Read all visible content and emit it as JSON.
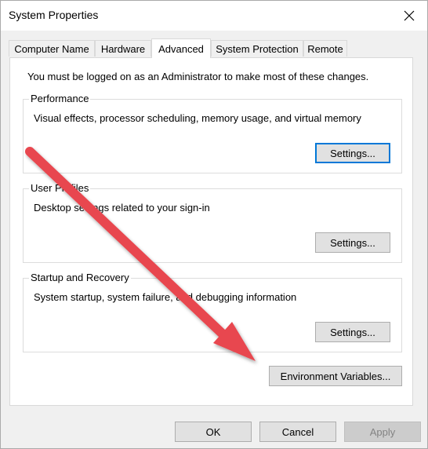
{
  "window": {
    "title": "System Properties",
    "close_glyph": "✕"
  },
  "tabs": [
    {
      "label": "Computer Name"
    },
    {
      "label": "Hardware"
    },
    {
      "label": "Advanced",
      "active": true
    },
    {
      "label": "System Protection"
    },
    {
      "label": "Remote"
    }
  ],
  "advanced": {
    "admin_notice": "You must be logged on as an Administrator to make most of these changes.",
    "performance": {
      "title": "Performance",
      "description": "Visual effects, processor scheduling, memory usage, and virtual memory",
      "button": "Settings..."
    },
    "user_profiles": {
      "title": "User Profiles",
      "description": "Desktop settings related to your sign-in",
      "button": "Settings..."
    },
    "startup_recovery": {
      "title": "Startup and Recovery",
      "description": "System startup, system failure, and debugging information",
      "button": "Settings..."
    },
    "env_button": "Environment Variables..."
  },
  "footer": {
    "ok": "OK",
    "cancel": "Cancel",
    "apply": "Apply"
  },
  "colors": {
    "annotation_arrow": "#e8474f",
    "focus_border": "#0078d7"
  }
}
